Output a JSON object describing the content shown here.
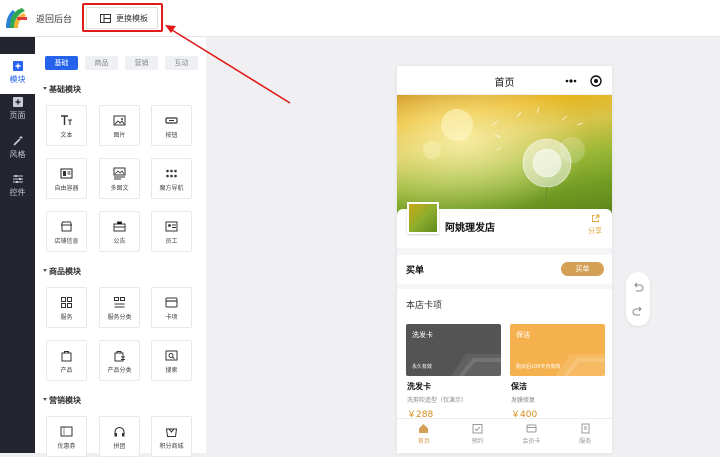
{
  "topbar": {
    "back_label": "返回后台",
    "swap_template_label": "更换模板"
  },
  "sidebar": {
    "items": [
      {
        "label": "模块",
        "icon": "plus-square-icon",
        "active": true
      },
      {
        "label": "页面",
        "icon": "plus-box-icon",
        "active": false
      },
      {
        "label": "风格",
        "icon": "magic-wand-icon",
        "active": false
      },
      {
        "label": "控件",
        "icon": "sliders-icon",
        "active": false
      }
    ]
  },
  "panel": {
    "tabs": [
      {
        "label": "基础",
        "active": true
      },
      {
        "label": "商品",
        "active": false
      },
      {
        "label": "营销",
        "active": false
      },
      {
        "label": "互动",
        "active": false
      }
    ],
    "sections": [
      {
        "title": "基础模块",
        "items": [
          "文本",
          "图片",
          "按钮",
          "自由容器",
          "多图文",
          "魔方导航",
          "店铺信息",
          "公告",
          "员工"
        ]
      },
      {
        "title": "商品模块",
        "items": [
          "服务",
          "服务分类",
          "卡项",
          "产品",
          "产品分类",
          "搜索"
        ]
      },
      {
        "title": "营销模块",
        "items": [
          "优惠券",
          "拼团",
          "积分商城"
        ]
      }
    ]
  },
  "phone": {
    "title": "首页",
    "shop_name": "阿姚理发店",
    "share_label": "分享",
    "buy_title": "买单",
    "buy_button": "买单",
    "cards_title": "本店卡项",
    "cards": [
      {
        "name": "洗发卡",
        "desc": "永久有效",
        "title": "洗发卡",
        "sub": "洗剪吹造型（仅演示）",
        "price": "￥288",
        "color": "#545454"
      },
      {
        "name": "保洁",
        "desc": "购买后100天内有效",
        "title": "保洁",
        "sub": "发膜修复",
        "price": "￥400",
        "color": "#f5b14e"
      }
    ],
    "tabbar": [
      {
        "label": "首页",
        "icon": "home-icon",
        "active": true
      },
      {
        "label": "预约",
        "icon": "calendar-check-icon",
        "active": false
      },
      {
        "label": "会员卡",
        "icon": "card-icon",
        "active": false
      },
      {
        "label": "服务",
        "icon": "book-icon",
        "active": false
      }
    ]
  },
  "colors": {
    "accent": "#2563eb",
    "gold": "#d4a055",
    "highlight": "#e21a1a",
    "sidebar_bg": "#23262e"
  }
}
